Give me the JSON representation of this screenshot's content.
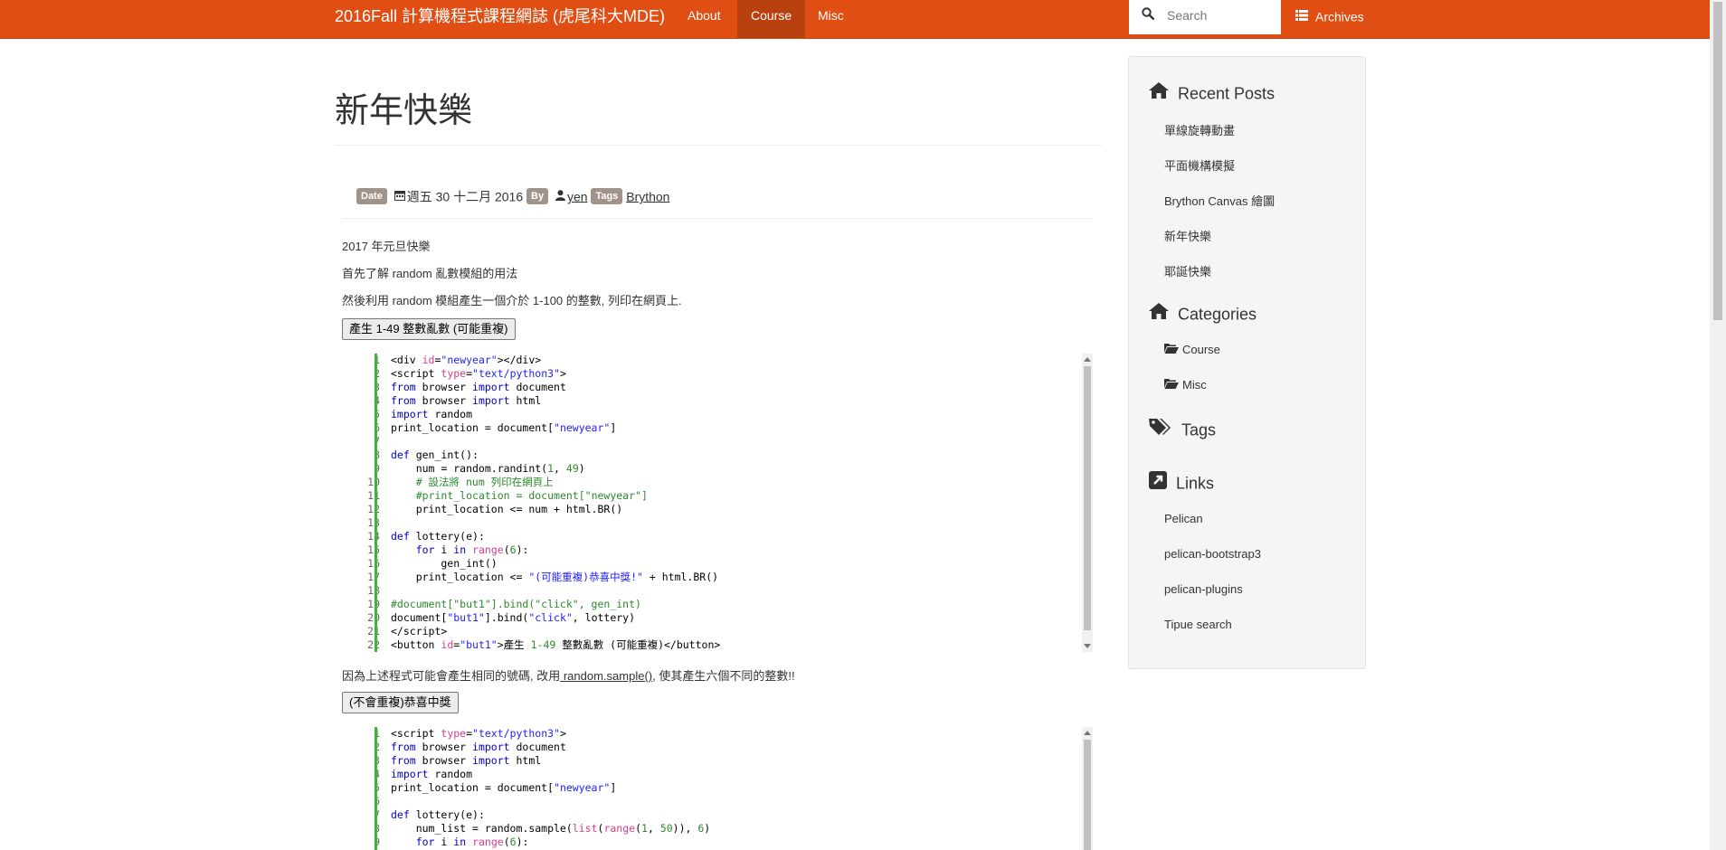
{
  "navbar": {
    "brand": "2016Fall 計算機程式課程網誌 (虎尾科大MDE)",
    "items": [
      {
        "label": "About"
      },
      {
        "label": "Course"
      },
      {
        "label": "Misc"
      }
    ],
    "search_placeholder": "Search",
    "archives_label": "Archives",
    "brand_color": "#e04e14"
  },
  "article": {
    "title": "新年快樂",
    "meta": {
      "date_label": "Date",
      "date_value": "週五 30 十二月 2016",
      "by_label": "By",
      "author": "yen",
      "tags_label": "Tags",
      "tag": "Brython"
    },
    "para1": "2017 年元旦快樂",
    "para2": "首先了解 random 亂數模組的用法",
    "para3": "然後利用 random 模組產生一個介於 1-100 的整數, 列印在網頁上.",
    "button1": "產生 1-49 整數亂數 (可能重複)",
    "para4_pre": "因為上述程式可能會產生相同的號碼, 改用",
    "para4_link": " random.sample()",
    "para4_post": ", 使其產生六個不同的整數!!",
    "button2": "(不會重複)恭喜中獎",
    "code1_line_count": 22,
    "code2_line_count": 9
  },
  "sidebar": {
    "recent_posts_title": "Recent Posts",
    "recent_posts": [
      "單線旋轉動畫",
      "平面機構模擬",
      "Brython Canvas 繪圖",
      "新年快樂",
      "耶誕快樂"
    ],
    "categories_title": "Categories",
    "categories": [
      "Course",
      "Misc"
    ],
    "tags_title": "Tags",
    "links_title": "Links",
    "links": [
      "Pelican",
      "pelican-bootstrap3",
      "pelican-plugins",
      "Tipue search"
    ]
  }
}
